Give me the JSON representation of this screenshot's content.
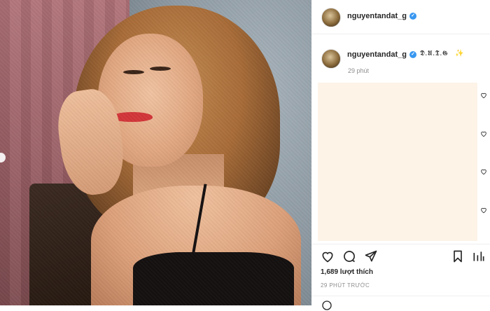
{
  "post": {
    "photo": {
      "description_icon": "post-photo"
    },
    "header": {
      "username": "nguyentandat_g",
      "verified": true
    },
    "caption": {
      "username": "nguyentandat_g",
      "text": "𝕯.𝖀.𝕿.𝕲",
      "emoji": "✨",
      "time": "29 phút"
    },
    "actions": {
      "like_icon": "heart-icon",
      "comment_icon": "comment-icon",
      "share_icon": "share-icon",
      "save_icon": "bookmark-icon"
    },
    "likes": "1,689 lượt thích",
    "timestamp": "29 PHÚT TRƯỚC"
  },
  "colors": {
    "verified_blue": "#3897f0",
    "text": "#262626",
    "muted": "#8e8e8e",
    "comment_bg": "#fdf3e7"
  }
}
